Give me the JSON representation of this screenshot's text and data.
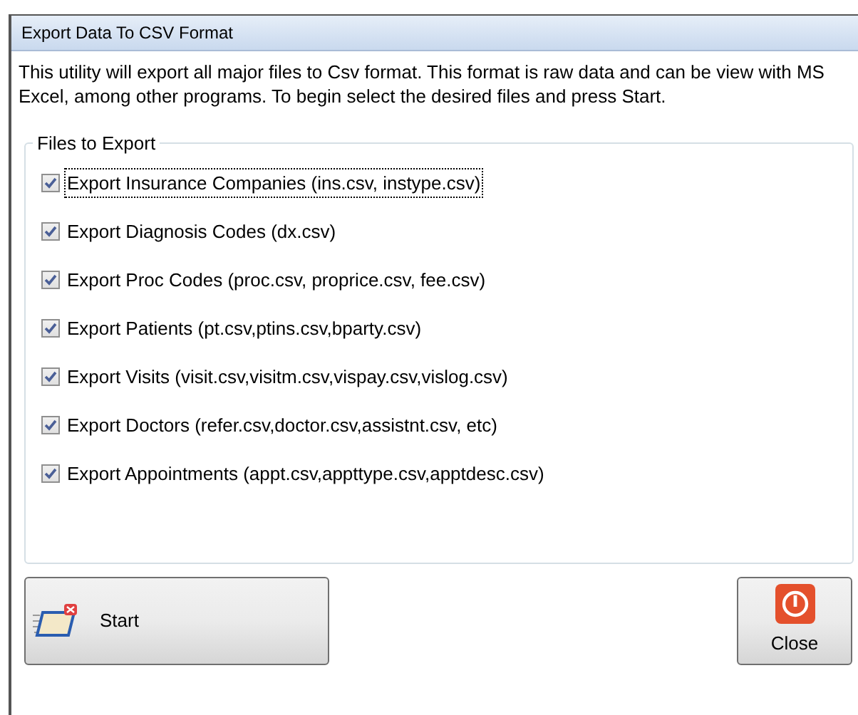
{
  "window": {
    "title": "Export Data To CSV Format"
  },
  "description": "This utility will export all major files to Csv format. This format is raw data and can be view with MS Excel, among other programs. To begin select the desired files and press Start.",
  "group": {
    "title": "Files to Export",
    "items": [
      {
        "label": "Export Insurance Companies (ins.csv, instype.csv)",
        "checked": true,
        "focused": true
      },
      {
        "label": "Export Diagnosis Codes (dx.csv)",
        "checked": true,
        "focused": false
      },
      {
        "label": "Export Proc Codes (proc.csv, proprice.csv, fee.csv)",
        "checked": true,
        "focused": false
      },
      {
        "label": "Export Patients (pt.csv,ptins.csv,bparty.csv)",
        "checked": true,
        "focused": false
      },
      {
        "label": "Export Visits (visit.csv,visitm.csv,vispay.csv,vislog.csv)",
        "checked": true,
        "focused": false
      },
      {
        "label": "Export Doctors (refer.csv,doctor.csv,assistnt.csv, etc)",
        "checked": true,
        "focused": false
      },
      {
        "label": "Export Appointments (appt.csv,appttype.csv,apptdesc.csv)",
        "checked": true,
        "focused": false
      }
    ]
  },
  "buttons": {
    "start": "Start",
    "close": "Close"
  }
}
